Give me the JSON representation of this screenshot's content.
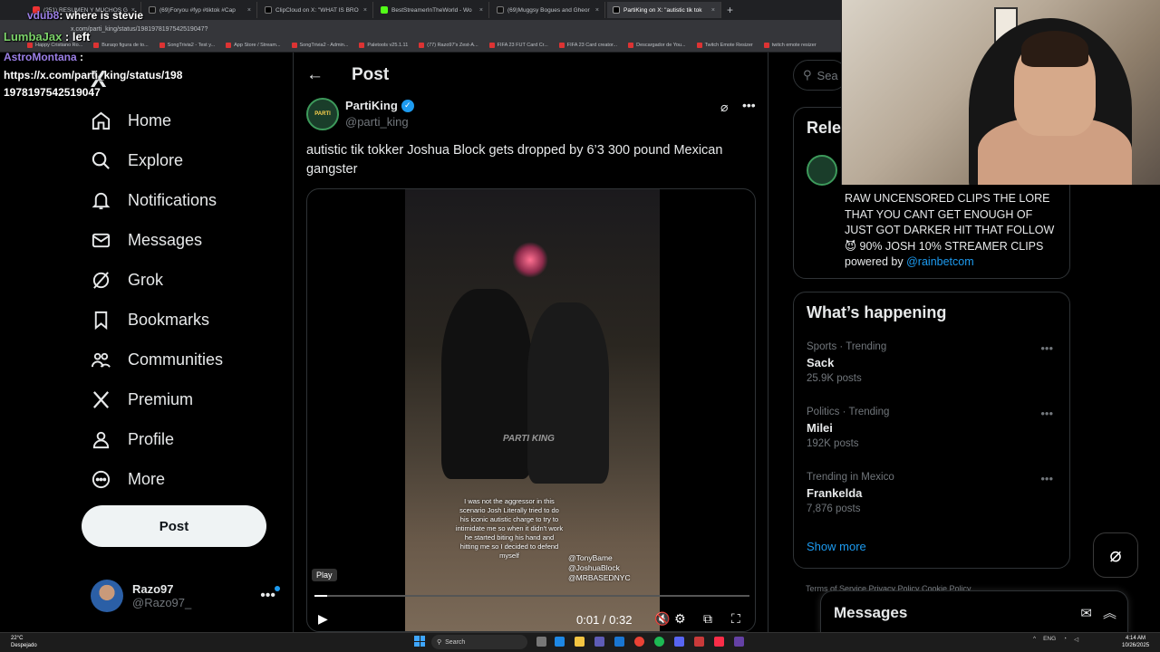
{
  "browser": {
    "tabs": [
      {
        "label": "(251) RESUMEN Y MUCHOS G"
      },
      {
        "label": "(69)Foryou #fyp #tiktok #Cap"
      },
      {
        "label": "ClipCloud on X: \"WHAT IS BRO"
      },
      {
        "label": "BestStreamerInTheWorld - Wo"
      },
      {
        "label": "(69)Muggsy Bogues and Gheor"
      },
      {
        "label": "PartiKing on X: \"autistic tik tok"
      }
    ],
    "url": "x.com/parti_king/status/1981978197542519047?",
    "bookmarks": [
      "Happy Cristiano Ro...",
      "Buraqo figura de to...",
      "SongTrivia2 - Test y...",
      "App Store / Stream...",
      "SongTrivia2 - Admin...",
      "Paletools v25.1.11",
      "(77) Razo97's Zest-A...",
      "FIFA 23 FUT Card Cr...",
      "FIFA 23 Card creator...",
      "Descargador de You...",
      "Twitch Emote Resizer",
      "twitch emote resizer"
    ]
  },
  "chat": {
    "line1_user": "vdub8",
    "line1_msg": ": where is stevie",
    "line2_user": "LumbaJax",
    "line2_msg": " : left",
    "line3_user": "AstroMontana",
    "line3_msg": " :",
    "line4_a": "https://x.com/parti_king/status/198",
    "line4_b": "1978197542519047"
  },
  "nav": {
    "logo": "X",
    "items": [
      {
        "label": "Home"
      },
      {
        "label": "Explore"
      },
      {
        "label": "Notifications"
      },
      {
        "label": "Messages"
      },
      {
        "label": "Grok"
      },
      {
        "label": "Bookmarks"
      },
      {
        "label": "Communities"
      },
      {
        "label": "Premium"
      },
      {
        "label": "Profile"
      },
      {
        "label": "More"
      }
    ],
    "post_button": "Post",
    "account": {
      "name": "Razo97",
      "handle": "@Razo97_"
    }
  },
  "post": {
    "header_title": "Post",
    "author_name": "PartiKing",
    "author_handle": "@parti_king",
    "text": "autistic tik tokker Joshua Block gets dropped by 6’3 300 pound Mexican gangster",
    "video": {
      "watermark": "PARTI KING",
      "caption": "I was not the aggressor in this scenario Josh Literally tried to do his iconic autistic charge to try to intimidate me so when it didn't work he started biting his hand and hitting me so I decided to defend myself",
      "tag1": "@TonyBame",
      "tag2": "@JoshuaBlock",
      "tag3": "@MRBASEDNYC",
      "tooltip": "Play",
      "time": "0:01 / 0:32",
      "progress": 0.03
    }
  },
  "sidebar": {
    "search_placeholder": "Sea",
    "relevant_title": "Rele",
    "relevant_bio": "RAW UNCENSORED CLIPS THE LORE THAT YOU CANT GET ENOUGH OF JUST GOT DARKER HIT THAT FOLLOW 😈 90% JOSH 10% STREAMER CLIPS",
    "relevant_powered": "powered by ",
    "relevant_link": "@rainbetcom",
    "happening_title": "What’s happening",
    "trends": [
      {
        "meta": "Sports · Trending",
        "name": "Sack",
        "count": "25.9K posts"
      },
      {
        "meta": "Politics · Trending",
        "name": "Milei",
        "count": "192K posts"
      },
      {
        "meta": "Trending in Mexico",
        "name": "Frankelda",
        "count": "7,876 posts"
      }
    ],
    "show_more": "Show more",
    "footer": "Terms of Service   Privacy Policy   Cookie Policy",
    "messages_title": "Messages"
  },
  "taskbar": {
    "weather_temp": "22°C",
    "weather_desc": "Despejado",
    "search": "Search",
    "lang": "ENG",
    "time": "4:14 AM",
    "date": "10/26/2025"
  }
}
